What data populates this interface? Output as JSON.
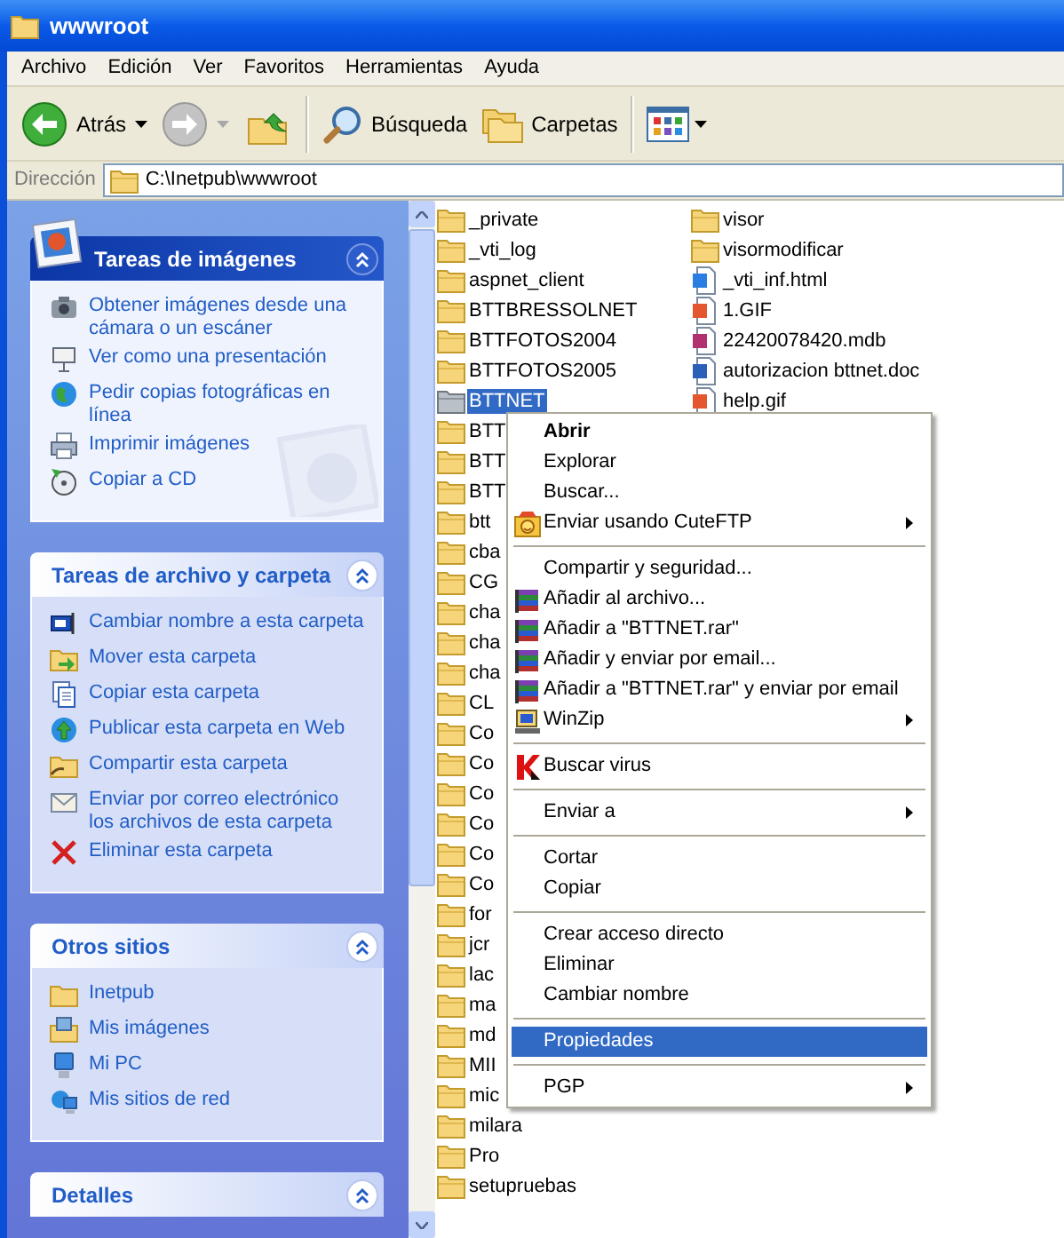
{
  "window": {
    "title": "wwwroot"
  },
  "menu_bar": [
    "Archivo",
    "Edición",
    "Ver",
    "Favoritos",
    "Herramientas",
    "Ayuda"
  ],
  "toolbar": [
    {
      "kind": "back",
      "label": "Atrás",
      "disabled": false
    },
    {
      "kind": "forward",
      "disabled": true
    },
    {
      "kind": "up"
    },
    {
      "kind": "separator"
    },
    {
      "kind": "search",
      "label": "Búsqueda"
    },
    {
      "kind": "folders",
      "label": "Carpetas"
    },
    {
      "kind": "separator"
    },
    {
      "kind": "views"
    }
  ],
  "address": {
    "label": "Dirección",
    "path": "C:\\Inetpub\\wwwroot"
  },
  "task_panels": [
    {
      "title": "Tareas de imágenes",
      "kind": "special",
      "expanded": true,
      "items": [
        "Obtener imágenes desde una cámara o un escáner",
        "Ver como una presentación",
        "Pedir copias fotográficas en línea",
        "Imprimir imágenes",
        "Copiar a CD"
      ]
    },
    {
      "title": "Tareas de archivo y carpeta",
      "kind": "normal",
      "expanded": true,
      "items": [
        "Cambiar nombre a esta carpeta",
        "Mover esta carpeta",
        "Copiar esta carpeta",
        "Publicar esta carpeta en Web",
        "Compartir esta carpeta",
        "Enviar por correo electrónico los archivos de esta carpeta",
        "Eliminar esta carpeta"
      ]
    },
    {
      "title": "Otros sitios",
      "kind": "normal",
      "expanded": true,
      "items": [
        "Inetpub",
        "Mis imágenes",
        "Mi PC",
        "Mis sitios de red"
      ]
    },
    {
      "title": "Detalles",
      "kind": "normal",
      "expanded": true
    }
  ],
  "files": {
    "column_1": [
      {
        "name": "_private",
        "kind": "folder",
        "selected": false
      },
      {
        "name": "_vti_log",
        "kind": "folder",
        "selected": false
      },
      {
        "name": "aspnet_client",
        "kind": "folder",
        "selected": false
      },
      {
        "name": "BTTBRESSOLNET",
        "kind": "folder",
        "selected": false
      },
      {
        "name": "BTTFOTOS2004",
        "kind": "folder",
        "selected": false
      },
      {
        "name": "BTTFOTOS2005",
        "kind": "folder",
        "selected": false
      },
      {
        "name": "BTTNET",
        "kind": "folder",
        "selected": true
      },
      {
        "name": "BTT",
        "kind": "folder",
        "selected": false
      },
      {
        "name": "BTT",
        "kind": "folder",
        "selected": false
      },
      {
        "name": "BTT",
        "kind": "folder",
        "selected": false
      },
      {
        "name": "btt",
        "kind": "folder",
        "selected": false
      },
      {
        "name": "cba",
        "kind": "folder",
        "selected": false
      },
      {
        "name": "CG",
        "kind": "folder",
        "selected": false
      },
      {
        "name": "cha",
        "kind": "folder",
        "selected": false
      },
      {
        "name": "cha",
        "kind": "folder",
        "selected": false
      },
      {
        "name": "cha",
        "kind": "folder",
        "selected": false
      },
      {
        "name": "CL",
        "kind": "folder",
        "selected": false
      },
      {
        "name": "Co",
        "kind": "folder",
        "selected": false
      },
      {
        "name": "Co",
        "kind": "folder",
        "selected": false
      },
      {
        "name": "Co",
        "kind": "folder",
        "selected": false
      },
      {
        "name": "Co",
        "kind": "folder",
        "selected": false
      },
      {
        "name": "Co",
        "kind": "folder",
        "selected": false
      },
      {
        "name": "Co",
        "kind": "folder",
        "selected": false
      },
      {
        "name": "for",
        "kind": "folder",
        "selected": false
      },
      {
        "name": "jcr",
        "kind": "folder",
        "selected": false
      },
      {
        "name": "lac",
        "kind": "folder",
        "selected": false
      },
      {
        "name": "ma",
        "kind": "folder",
        "selected": false
      },
      {
        "name": "md",
        "kind": "folder",
        "selected": false
      },
      {
        "name": "MII",
        "kind": "folder",
        "selected": false
      },
      {
        "name": "mic",
        "kind": "folder",
        "selected": false
      },
      {
        "name": "milara",
        "kind": "folder",
        "selected": false
      },
      {
        "name": "Pro",
        "kind": "folder",
        "selected": false
      },
      {
        "name": "setupruebas",
        "kind": "folder",
        "selected": false
      }
    ],
    "column_2": [
      {
        "name": "visor",
        "kind": "folder",
        "selected": false
      },
      {
        "name": "visormodificar",
        "kind": "folder",
        "selected": false
      },
      {
        "name": "_vti_inf.html",
        "kind": "html",
        "selected": false
      },
      {
        "name": "1.GIF",
        "kind": "image",
        "selected": false
      },
      {
        "name": "22420078420.mdb",
        "kind": "database",
        "selected": false
      },
      {
        "name": "autorizacion bttnet.doc",
        "kind": "document",
        "selected": false
      },
      {
        "name": "help.gif",
        "kind": "image",
        "selected": false
      }
    ]
  },
  "context_menu": [
    {
      "kind": "item",
      "label": "Abrir",
      "default": true,
      "submenu": false,
      "selected": false
    },
    {
      "kind": "item",
      "label": "Explorar",
      "default": false,
      "submenu": false,
      "selected": false
    },
    {
      "kind": "item",
      "label": "Buscar...",
      "default": false,
      "submenu": false,
      "selected": false
    },
    {
      "kind": "item",
      "label": "Enviar usando CuteFTP",
      "default": false,
      "submenu": true,
      "selected": false
    },
    {
      "kind": "separator"
    },
    {
      "kind": "item",
      "label": "Compartir y seguridad...",
      "default": false,
      "submenu": false,
      "selected": false
    },
    {
      "kind": "item",
      "label": "Añadir al archivo...",
      "default": false,
      "submenu": false,
      "selected": false
    },
    {
      "kind": "item",
      "label": "Añadir a \"BTTNET.rar\"",
      "default": false,
      "submenu": false,
      "selected": false
    },
    {
      "kind": "item",
      "label": "Añadir y enviar por email...",
      "default": false,
      "submenu": false,
      "selected": false
    },
    {
      "kind": "item",
      "label": "Añadir a \"BTTNET.rar\" y enviar por email",
      "default": false,
      "submenu": false,
      "selected": false
    },
    {
      "kind": "item",
      "label": "WinZip",
      "default": false,
      "submenu": true,
      "selected": false
    },
    {
      "kind": "separator"
    },
    {
      "kind": "item",
      "label": "Buscar virus",
      "default": false,
      "submenu": false,
      "selected": false
    },
    {
      "kind": "separator"
    },
    {
      "kind": "item",
      "label": "Enviar a",
      "default": false,
      "submenu": true,
      "selected": false
    },
    {
      "kind": "separator"
    },
    {
      "kind": "item",
      "label": "Cortar",
      "default": false,
      "submenu": false,
      "selected": false
    },
    {
      "kind": "item",
      "label": "Copiar",
      "default": false,
      "submenu": false,
      "selected": false
    },
    {
      "kind": "separator"
    },
    {
      "kind": "item",
      "label": "Crear acceso directo",
      "default": false,
      "submenu": false,
      "selected": false
    },
    {
      "kind": "item",
      "label": "Eliminar",
      "default": false,
      "submenu": false,
      "selected": false
    },
    {
      "kind": "item",
      "label": "Cambiar nombre",
      "default": false,
      "submenu": false,
      "selected": false
    },
    {
      "kind": "separator"
    },
    {
      "kind": "item",
      "label": "Propiedades",
      "default": false,
      "submenu": false,
      "selected": true
    },
    {
      "kind": "separator"
    },
    {
      "kind": "item",
      "label": "PGP",
      "default": false,
      "submenu": true,
      "selected": false
    }
  ]
}
